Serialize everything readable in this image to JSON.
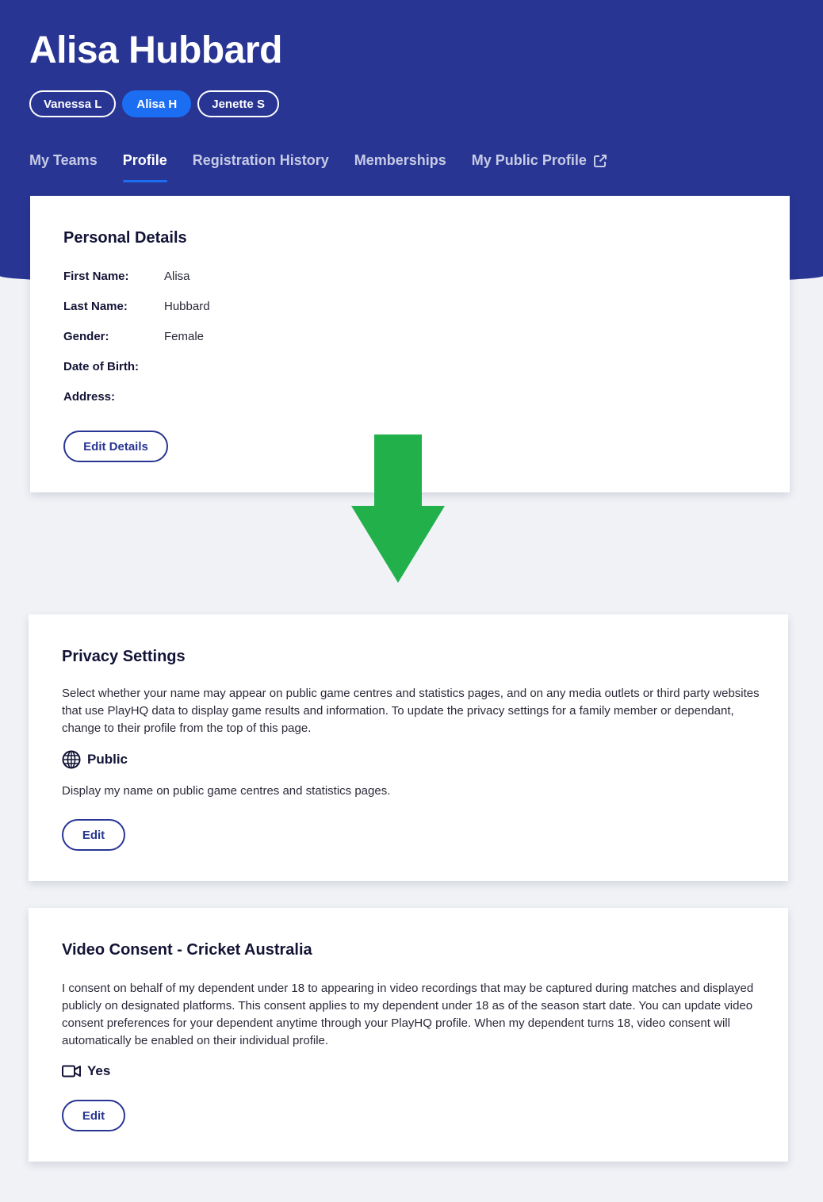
{
  "header": {
    "title": "Alisa Hubbard",
    "profiles": [
      {
        "label": "Vanessa L",
        "active": false
      },
      {
        "label": "Alisa H",
        "active": true
      },
      {
        "label": "Jenette S",
        "active": false
      }
    ],
    "tabs": [
      {
        "label": "My Teams",
        "active": false
      },
      {
        "label": "Profile",
        "active": true
      },
      {
        "label": "Registration History",
        "active": false
      },
      {
        "label": "Memberships",
        "active": false
      },
      {
        "label": "My Public Profile",
        "active": false,
        "icon": "external-link-icon"
      }
    ]
  },
  "personal_details": {
    "heading": "Personal Details",
    "fields": [
      {
        "label": "First Name:",
        "value": "Alisa"
      },
      {
        "label": "Last Name:",
        "value": "Hubbard"
      },
      {
        "label": "Gender:",
        "value": "Female"
      },
      {
        "label": "Date of Birth:",
        "value": ""
      },
      {
        "label": "Address:",
        "value": ""
      }
    ],
    "edit_label": "Edit Details"
  },
  "privacy_settings": {
    "heading": "Privacy Settings",
    "description": "Select whether your name may appear on public game centres and statistics pages, and on any media outlets or third party websites that use PlayHQ data to display game results and information. To update the privacy settings for a family member or dependant, change to their profile from the top of this page.",
    "status_icon": "globe-icon",
    "status": "Public",
    "status_description": "Display my name on public game centres and statistics pages.",
    "edit_label": "Edit"
  },
  "video_consent": {
    "heading": "Video Consent - Cricket Australia",
    "description": "I consent on behalf of my dependent under 18 to appearing in video recordings that may be captured during matches and displayed publicly on designated platforms. This consent applies to my dependent under 18 as of the season start date. You can update video consent preferences for your dependent anytime through your PlayHQ profile. When my dependent turns 18, video consent will automatically be enabled on their individual profile.",
    "status_icon": "video-camera-icon",
    "status": "Yes",
    "edit_label": "Edit"
  },
  "colors": {
    "header_bg": "#283593",
    "active_accent": "#1b6ef2",
    "page_bg": "#f0f2f6",
    "annotation_arrow": "#22b04b"
  }
}
